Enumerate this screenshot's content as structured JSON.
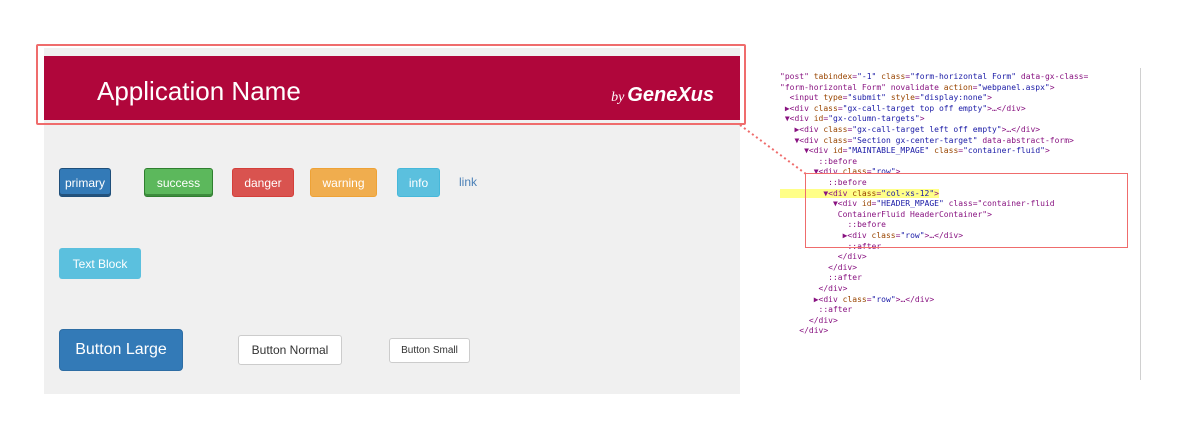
{
  "header": {
    "app_name": "Application Name",
    "brand_by": "by",
    "brand_name": "GeneXus",
    "background": "#b0063b"
  },
  "buttons_row1": {
    "primary": "primary",
    "success": "success",
    "danger": "danger",
    "warning": "warning",
    "info": "info",
    "link": "link"
  },
  "text_block": "Text Block",
  "buttons_row3": {
    "large": "Button Large",
    "normal": "Button Normal",
    "small": "Button Small"
  },
  "colors": {
    "primary": "#337ab7",
    "success": "#5cb85c",
    "danger": "#d9534f",
    "warning": "#f0ad4e",
    "info": "#5bc0de",
    "highlight": "#ef6c6c"
  },
  "dom_lines": [
    "\"post\" tabindex=\"-1\" class=\"form-horizontal Form\" data-gx-class=",
    "\"form-horizontal Form\" novalidate action=\"webpanel.aspx\">",
    "  <input type=\"submit\" style=\"display:none\">",
    " ▶<div class=\"gx-call-target top off empty\">…</div>",
    " ▼<div id=\"gx-column-targets\">",
    "   ▶<div class=\"gx-call-target left off empty\">…</div>",
    "   ▼<div class=\"Section gx-center-target\" data-abstract-form>",
    "     ▼<div id=\"MAINTABLE_MPAGE\" class=\"container-fluid\">",
    "        ::before",
    "       ▼<div class=\"row\">",
    "          ::before",
    "         ▼<div class=\"col-xs-12\">",
    "           ▼<div id=\"HEADER_MPAGE\" class=\"container-fluid",
    "            ContainerFluid HeaderContainer\">",
    "              ::before",
    "             ▶<div class=\"row\">…</div>",
    "              ::after",
    "            </div>",
    "          </div>",
    "          ::after",
    "        </div>",
    "       ▶<div class=\"row\">…</div>",
    "        ::after",
    "      </div>",
    "    </div>"
  ]
}
